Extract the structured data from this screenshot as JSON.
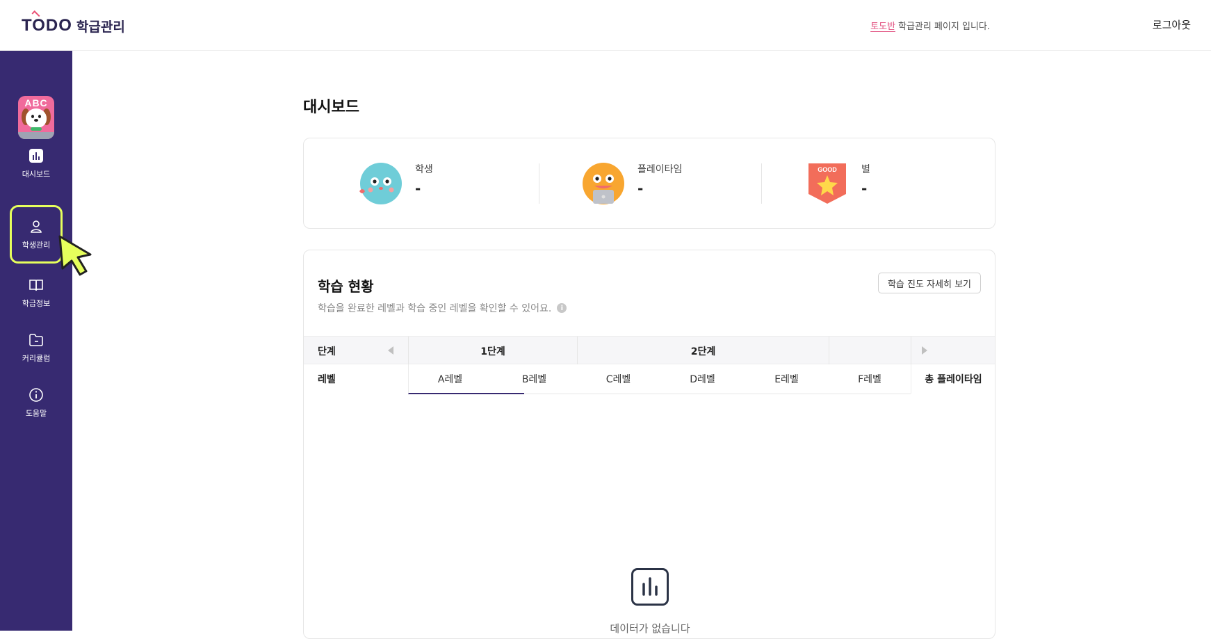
{
  "header": {
    "logo_text": "TODO",
    "app_name": "학급관리",
    "class_name": "토도반",
    "notice_suffix": "학급관리 페이지 입니다.",
    "logout_label": "로그아웃"
  },
  "sidebar": {
    "avatar_text": "ABC",
    "items": [
      {
        "label": "대시보드",
        "icon": "bar-chart-icon"
      },
      {
        "label": "학생관리",
        "icon": "person-icon",
        "active": true
      },
      {
        "label": "학급정보",
        "icon": "book-icon"
      },
      {
        "label": "커리큘럼",
        "icon": "folder-icon"
      },
      {
        "label": "도움말",
        "icon": "info-icon"
      }
    ]
  },
  "dashboard": {
    "title": "대시보드",
    "stats": [
      {
        "label": "학생",
        "value": "-",
        "icon": "blue-character-icon"
      },
      {
        "label": "플레이타임",
        "value": "-",
        "icon": "orange-character-icon"
      },
      {
        "label": "별",
        "value": "-",
        "icon": "good-star-badge-icon",
        "badge_text": "GOOD"
      }
    ]
  },
  "progress": {
    "title": "학습 현황",
    "subtitle": "학습을 완료한 레벨과 학습 중인 레벨을 확인할 수 있어요.",
    "detail_button": "학습 진도 자세히 보기",
    "stage_header": "단계",
    "level_header": "레벨",
    "stages": [
      "1단계",
      "2단계"
    ],
    "levels": [
      "A레벨",
      "B레벨",
      "C레벨",
      "D레벨",
      "E레벨",
      "F레벨"
    ],
    "active_level": "A레벨",
    "total_playtime_header": "총 플레이타임",
    "empty_message": "데이터가 없습니다"
  },
  "colors": {
    "sidebar_bg": "#372a71",
    "highlight": "#e6ff5c",
    "accent_pink": "#e0487a"
  }
}
